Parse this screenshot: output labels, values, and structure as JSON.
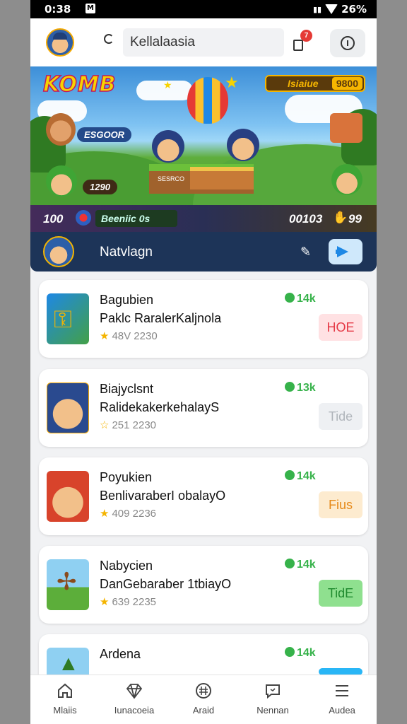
{
  "status_bar": {
    "time": "0:38",
    "battery": "26%"
  },
  "header": {
    "search": {
      "placeholder": "Kellalaasia"
    },
    "notification_count": "7"
  },
  "banner": {
    "game_logo": "KOMB",
    "score_pill": {
      "label": "Isiaiue",
      "value": "9800"
    },
    "left_tag": "ESGOOR",
    "left_value": "1290",
    "platform_text": "SESRCO",
    "bottom_left_score": "100",
    "progress_label": "Beeniic 0s",
    "bottom_right_score": "00103",
    "bottom_right_num": "99"
  },
  "nav_strip": {
    "title": "Natvlagn"
  },
  "games": [
    {
      "title": "Bagubien",
      "subtitle": "Paklc RaralerKaljnola",
      "meta": "48V 2230",
      "price": "14k",
      "button": "HOE",
      "button_style": "red",
      "thumb": "gold-key"
    },
    {
      "title": "Biajyclsnt",
      "subtitle": "RalidekakerkehalayS",
      "meta": "251 2230",
      "price": "13k",
      "button": "Tide",
      "button_style": "gray",
      "thumb": "captain"
    },
    {
      "title": "Poyukien",
      "subtitle": "BenlivaraberI obalayO",
      "meta": "409 2236",
      "price": "14k",
      "button": "Fius",
      "button_style": "orange",
      "thumb": "captain-red"
    },
    {
      "title": "Nabycien",
      "subtitle": "DanGebaraber 1tbiayO",
      "meta": "639 2235",
      "price": "14k",
      "button": "TidE",
      "button_style": "green",
      "thumb": "windmill"
    },
    {
      "title": "Ardena",
      "subtitle": "",
      "meta": "",
      "price": "14k",
      "button": "",
      "button_style": "blue",
      "thumb": "tree"
    }
  ],
  "bottom_nav": [
    {
      "label": "Mlaiis",
      "icon": "home-icon"
    },
    {
      "label": "Iunacoeia",
      "icon": "diamond-icon"
    },
    {
      "label": "Araid",
      "icon": "grid-circle-icon"
    },
    {
      "label": "Nennan",
      "icon": "message-icon"
    },
    {
      "label": "Audea",
      "icon": "menu-icon"
    }
  ]
}
